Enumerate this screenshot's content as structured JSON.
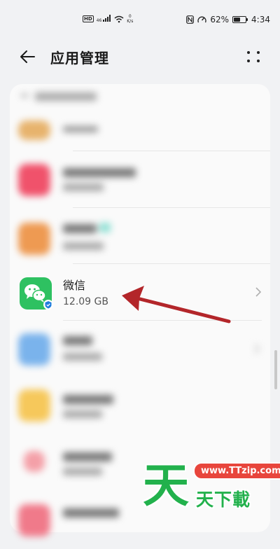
{
  "status_bar": {
    "hd": "HD",
    "signal": "46",
    "net_speed_top": "0",
    "net_speed_unit": "K/s",
    "battery_percent": "62%",
    "battery_level": 0.62,
    "time": "4:34"
  },
  "header": {
    "title": "应用管理"
  },
  "app_list": {
    "wechat": {
      "name": "微信",
      "size": "12.09 GB"
    }
  },
  "colors": {
    "wechat_green": "#2ec161",
    "arrow_red": "#b3262a"
  },
  "watermark": {
    "big": "天",
    "url": "www.TTzip.com",
    "small": "天下載"
  }
}
